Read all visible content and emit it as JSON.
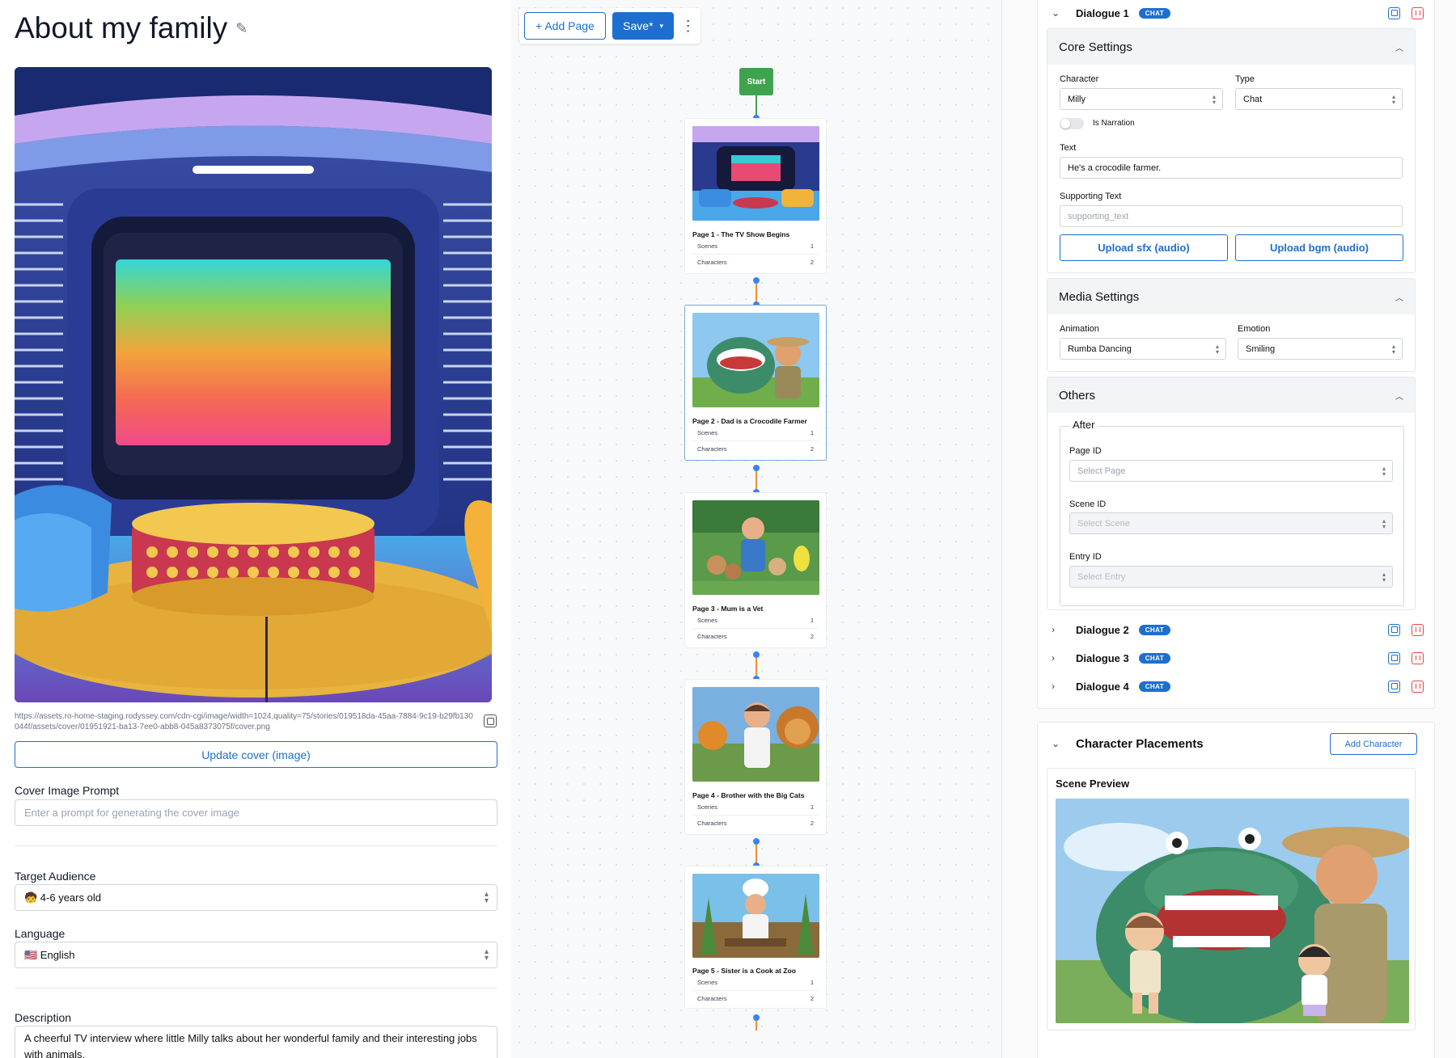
{
  "story": {
    "title": "About my family",
    "cover_url": "https://assets.ro-home-staging.rodyssey.com/cdn-cgi/image/width=1024,quality=75/stories/019518da-45aa-7884-9c19-b29fb130044f/assets/cover/01951921-ba13-7ee0-abb8-045a8373075f/cover.png",
    "update_cover_label": "Update cover (image)",
    "cover_prompt_label": "Cover Image Prompt",
    "cover_prompt_placeholder": "Enter a prompt for generating the cover image",
    "audience_label": "Target Audience",
    "audience_value": "🧒 4-6 years old",
    "language_label": "Language",
    "language_value": "🇺🇸 English",
    "description_label": "Description",
    "description_value": "A cheerful TV interview where little Milly talks about her wonderful family and their interesting jobs with animals."
  },
  "toolbar": {
    "add_page": "+ Add Page",
    "save": "Save*",
    "save_caret": "▾",
    "more": "⋮"
  },
  "flow": {
    "start_label": "Start",
    "scenes_label": "Scenes",
    "characters_label": "Characters",
    "pages": [
      {
        "title": "Page 1 - The TV Show Begins",
        "scenes": "1",
        "characters": "2"
      },
      {
        "title": "Page 2 - Dad is a Crocodile Farmer",
        "scenes": "1",
        "characters": "2"
      },
      {
        "title": "Page 3 - Mum is a Vet",
        "scenes": "1",
        "characters": "2"
      },
      {
        "title": "Page 4 - Brother with the Big Cats",
        "scenes": "1",
        "characters": "2"
      },
      {
        "title": "Page 5 - Sister is a Cook at Zoo",
        "scenes": "1",
        "characters": "2"
      }
    ],
    "zoom": {
      "in": "+",
      "out": "−",
      "fit": "⛶",
      "lock": "🔒"
    }
  },
  "dialogue": {
    "name": "Dialogue 1",
    "chip": "CHAT",
    "core": {
      "title": "Core Settings",
      "character_label": "Character",
      "character_value": "Milly",
      "type_label": "Type",
      "type_value": "Chat",
      "narration_label": "Is Narration",
      "text_label": "Text",
      "text_value": "He's a crocodile farmer.",
      "supporting_label": "Supporting Text",
      "supporting_placeholder": "supporting_text",
      "upload_sfx": "Upload sfx (audio)",
      "upload_bgm": "Upload bgm (audio)"
    },
    "media": {
      "title": "Media Settings",
      "animation_label": "Animation",
      "animation_value": "Rumba Dancing",
      "emotion_label": "Emotion",
      "emotion_value": "Smiling"
    },
    "others": {
      "title": "Others",
      "after_legend": "After",
      "page_id_label": "Page ID",
      "page_id_placeholder": "Select Page",
      "scene_id_label": "Scene ID",
      "scene_id_placeholder": "Select Scene",
      "entry_id_label": "Entry ID",
      "entry_id_placeholder": "Select Entry"
    }
  },
  "other_dialogues": [
    {
      "name": "Dialogue 2",
      "chip": "CHAT"
    },
    {
      "name": "Dialogue 3",
      "chip": "CHAT"
    },
    {
      "name": "Dialogue 4",
      "chip": "CHAT"
    }
  ],
  "placements": {
    "title": "Character Placements",
    "add_character": "Add Character",
    "scene_preview_label": "Scene Preview"
  },
  "colors": {
    "accent": "#1d6fcf",
    "start_node": "#3fa34d",
    "connector": "#f28c38",
    "danger": "#ef4444"
  }
}
